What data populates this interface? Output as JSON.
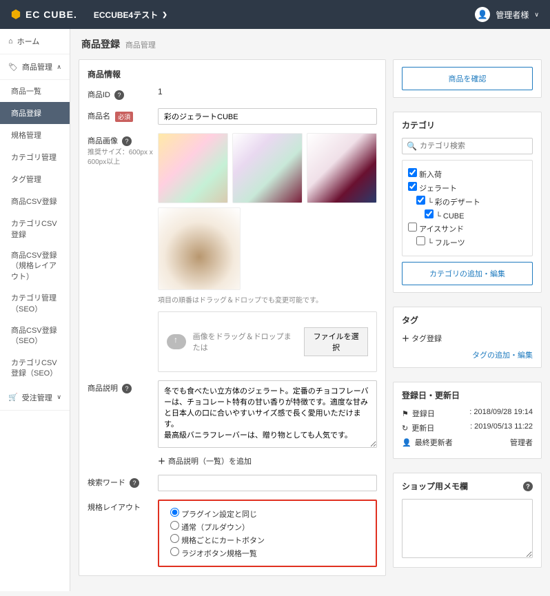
{
  "topbar": {
    "logo": "EC CUBE.",
    "site": "ECCUBE4テスト",
    "user": "管理者様"
  },
  "sidebar": {
    "home": "ホーム",
    "product_mgmt": "商品管理",
    "items": [
      "商品一覧",
      "商品登録",
      "規格管理",
      "カテゴリ管理",
      "タグ管理",
      "商品CSV登録",
      "カテゴリCSV登録",
      "商品CSV登録（規格レイアウト）",
      "カテゴリ管理（SEO）",
      "商品CSV登録（SEO）",
      "カテゴリCSV登録（SEO）"
    ],
    "order_mgmt": "受注管理"
  },
  "page": {
    "title": "商品登録",
    "bread": "商品管理"
  },
  "section": {
    "info": "商品情報"
  },
  "labels": {
    "id": "商品ID",
    "name": "商品名",
    "image": "商品画像",
    "image_hint": "推奨サイズ：600px x 600px以上",
    "desc": "商品説明",
    "keyword": "検索ワード",
    "layout": "規格レイアウト",
    "required": "必須"
  },
  "values": {
    "id": "1",
    "name": "彩のジェラートCUBE",
    "image_order_hint": "項目の順番はドラッグ＆ドロップでも変更可能です。",
    "dropzone": "画像をドラッグ＆ドロップまたは",
    "file_btn": "ファイルを選択",
    "desc": "冬でも食べたい立方体のジェラート。定番のチョコフレーバーは、チョコレート特有の甘い香りが特徴です。適度な甘みと日本人の口に合いやすいサイズ感で長く愛用いただけます。\n最高級バニラフレーバーは、贈り物としても人気です。",
    "add_desc": "商品説明（一覧）を追加"
  },
  "radios": {
    "opts": [
      "プラグイン設定と同じ",
      "通常（プルダウン）",
      "規格ごとにカートボタン",
      "ラジオボタン規格一覧"
    ],
    "selected": 0
  },
  "right": {
    "confirm_btn": "商品を確認",
    "cat_title": "カテゴリ",
    "cat_ph": "カテゴリ検索",
    "cats": [
      {
        "label": "新入荷",
        "c": true,
        "i": 0
      },
      {
        "label": "ジェラート",
        "c": true,
        "i": 0
      },
      {
        "label": "└ 彩のデザート",
        "c": true,
        "i": 1
      },
      {
        "label": "└ CUBE",
        "c": true,
        "i": 2
      },
      {
        "label": "アイスサンド",
        "c": false,
        "i": 0
      },
      {
        "label": "└ フルーツ",
        "c": false,
        "i": 1
      }
    ],
    "cat_edit_btn": "カテゴリの追加・編集",
    "tag_title": "タグ",
    "tag_add": "タグ登録",
    "tag_link": "タグの追加・編集",
    "meta_title": "登録日・更新日",
    "meta": [
      {
        "k": "登録日",
        "v": ": 2018/09/28 19:14"
      },
      {
        "k": "更新日",
        "v": ": 2019/05/13 11:22"
      },
      {
        "k": "最終更新者",
        "v": "管理者"
      }
    ],
    "memo_title": "ショップ用メモ欄"
  }
}
